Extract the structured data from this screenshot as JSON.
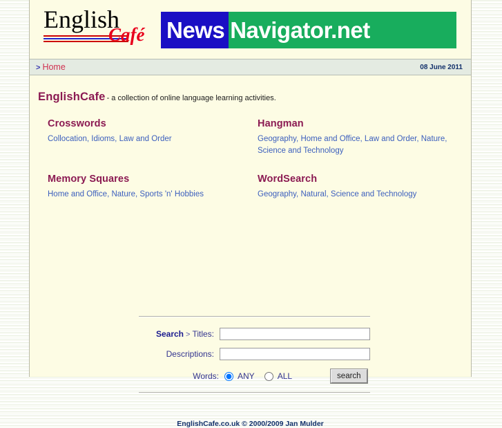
{
  "header": {
    "logo": {
      "word": "English",
      "script": "Café"
    },
    "banner": {
      "news": "News",
      "navigator": "Navigator.net"
    }
  },
  "breadcrumb": {
    "arrow": ">",
    "home_label": "Home",
    "date": "08 June 2011"
  },
  "site": {
    "name": "EnglishCafe",
    "tagline": "- a collection of online language learning activities."
  },
  "sections": [
    {
      "title": "Crosswords",
      "links": [
        "Collocation",
        "Idioms",
        "Law and Order"
      ]
    },
    {
      "title": "Hangman",
      "links": [
        "Geography",
        "Home and Office",
        "Law and Order",
        "Nature",
        "Science and Technology"
      ]
    },
    {
      "title": "Memory Squares",
      "links": [
        "Home and Office",
        "Nature",
        "Sports 'n' Hobbies"
      ]
    },
    {
      "title": "WordSearch",
      "links": [
        "Geography",
        "Natural",
        "Science and Technology"
      ]
    }
  ],
  "search": {
    "label_search": "Search",
    "label_gt": ">",
    "label_titles": "Titles:",
    "label_descriptions": "Descriptions:",
    "label_words": "Words:",
    "titles_value": "",
    "descriptions_value": "",
    "option_any": "ANY",
    "option_all": "ALL",
    "selected_option": "ANY",
    "button_label": "search"
  },
  "footer": {
    "text": "EnglishCafe.co.uk © 2000/2009 Jan Mulder"
  },
  "colors": {
    "panel_bg": "#fdfce4",
    "heading": "#8b1a52",
    "link": "#3c5fbd",
    "banner_blue": "#1a0fc4",
    "banner_green": "#18ad5d",
    "crumb_red": "#d03050",
    "navy": "#12306b"
  }
}
